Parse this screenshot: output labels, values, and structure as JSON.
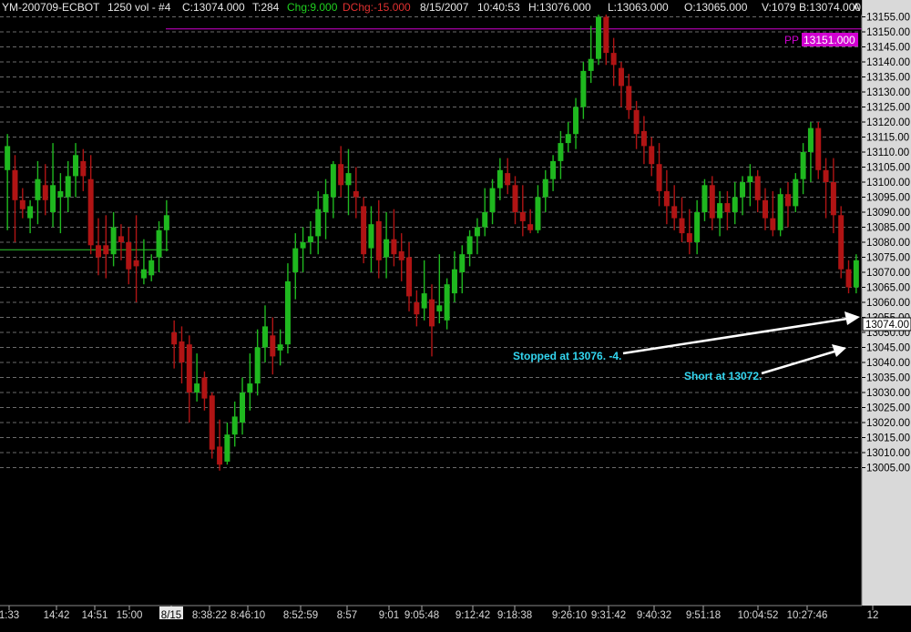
{
  "header": {
    "symbol": "YM-200709-ECBOT",
    "interval": "1250 vol - #4",
    "close": "C:13074.000",
    "ticks": "T:284",
    "change": "Chg:9.000",
    "dchange": "DChg:-15.000",
    "date": "8/15/2007",
    "time": "10:40:53",
    "high": "H:13076.000",
    "low": "L:13063.000",
    "open": "O:13065.000",
    "volume": "V:1079",
    "bid": "B:13074.000",
    "tail": "A"
  },
  "colors": {
    "background": "#000000",
    "up": "#1fb81f",
    "down": "#b01414",
    "grid": "#6a6a6a",
    "pivot": "#d000d0",
    "support": "#2ecc2e",
    "axis_panel": "#d9d9d9",
    "annotation": "#33d6f0"
  },
  "chart_data": {
    "type": "candlestick",
    "ylim": [
      13004,
      13157
    ],
    "y_ticks": [
      "13155.00",
      "13150.00",
      "13145.00",
      "13140.00",
      "13135.00",
      "13130.00",
      "13125.00",
      "13120.00",
      "13115.00",
      "13110.00",
      "13105.00",
      "13100.00",
      "13095.00",
      "13090.00",
      "13085.00",
      "13080.00",
      "13075.00",
      "13070.00",
      "13065.00",
      "13060.00",
      "13055.00",
      "13050.00",
      "13045.00",
      "13040.00",
      "13035.00",
      "13030.00",
      "13025.00",
      "13020.00",
      "13015.00",
      "13010.00",
      "13005.00"
    ],
    "x_labels": [
      "1:33",
      "14:42",
      "14:51",
      "15:00",
      "8/15",
      "8:38:22",
      "8:46:10",
      "8:52:59",
      "8:57",
      "9:01",
      "9:05:48",
      "9:12:42",
      "9:18:38",
      "9:26:10",
      "9:31:42",
      "9:40:32",
      "9:51:18",
      "10:04:52",
      "10:27:46",
      "12"
    ],
    "last_price_label": "13074.00",
    "pivot": {
      "label": "PP",
      "value_label": "13151.000",
      "value": 13151
    },
    "support_level": 13077.5,
    "candles": [
      {
        "o": 13104,
        "h": 13116,
        "l": 13084,
        "c": 13112
      },
      {
        "o": 13104,
        "h": 13109,
        "l": 13080,
        "c": 13094
      },
      {
        "o": 13094,
        "h": 13098,
        "l": 13088,
        "c": 13091
      },
      {
        "o": 13088,
        "h": 13094,
        "l": 13083,
        "c": 13092
      },
      {
        "o": 13094,
        "h": 13107,
        "l": 13086,
        "c": 13101
      },
      {
        "o": 13099,
        "h": 13106,
        "l": 13089,
        "c": 13094
      },
      {
        "o": 13090,
        "h": 13113,
        "l": 13085,
        "c": 13099
      },
      {
        "o": 13095,
        "h": 13103,
        "l": 13083,
        "c": 13097
      },
      {
        "o": 13095,
        "h": 13107,
        "l": 13090,
        "c": 13102
      },
      {
        "o": 13102,
        "h": 13113,
        "l": 13095,
        "c": 13109
      },
      {
        "o": 13107,
        "h": 13111,
        "l": 13097,
        "c": 13102
      },
      {
        "o": 13101,
        "h": 13109,
        "l": 13076,
        "c": 13079
      },
      {
        "o": 13079,
        "h": 13088,
        "l": 13069,
        "c": 13075
      },
      {
        "o": 13079,
        "h": 13089,
        "l": 13068,
        "c": 13076
      },
      {
        "o": 13076,
        "h": 13090,
        "l": 13072,
        "c": 13085
      },
      {
        "o": 13082,
        "h": 13086,
        "l": 13074,
        "c": 13080
      },
      {
        "o": 13080,
        "h": 13085,
        "l": 13066,
        "c": 13071
      },
      {
        "o": 13074,
        "h": 13089,
        "l": 13060,
        "c": 13072
      },
      {
        "o": 13068,
        "h": 13081,
        "l": 13066,
        "c": 13071
      },
      {
        "o": 13069,
        "h": 13076,
        "l": 13067,
        "c": 13074
      },
      {
        "o": 13075,
        "h": 13087,
        "l": 13070,
        "c": 13084
      },
      {
        "o": 13084,
        "h": 13094,
        "l": 13077,
        "c": 13089
      },
      {
        "o": 13050,
        "h": 13054,
        "l": 13038,
        "c": 13046
      },
      {
        "o": 13047,
        "h": 13052,
        "l": 13033,
        "c": 13040
      },
      {
        "o": 13046,
        "h": 13049,
        "l": 13020,
        "c": 13030
      },
      {
        "o": 13030,
        "h": 13043,
        "l": 13027,
        "c": 13033
      },
      {
        "o": 13035,
        "h": 13037,
        "l": 13024,
        "c": 13028
      },
      {
        "o": 13029,
        "h": 13030,
        "l": 13008,
        "c": 13011
      },
      {
        "o": 13012,
        "h": 13021,
        "l": 13004,
        "c": 13006
      },
      {
        "o": 13007,
        "h": 13020,
        "l": 13006,
        "c": 13016
      },
      {
        "o": 13016,
        "h": 13027,
        "l": 13012,
        "c": 13022
      },
      {
        "o": 13020,
        "h": 13035,
        "l": 13016,
        "c": 13030
      },
      {
        "o": 13030,
        "h": 13043,
        "l": 13024,
        "c": 13033
      },
      {
        "o": 13033,
        "h": 13051,
        "l": 13029,
        "c": 13045
      },
      {
        "o": 13045,
        "h": 13059,
        "l": 13040,
        "c": 13052
      },
      {
        "o": 13049,
        "h": 13055,
        "l": 13036,
        "c": 13042
      },
      {
        "o": 13044,
        "h": 13051,
        "l": 13039,
        "c": 13046
      },
      {
        "o": 13046,
        "h": 13073,
        "l": 13043,
        "c": 13067
      },
      {
        "o": 13070,
        "h": 13083,
        "l": 13061,
        "c": 13078
      },
      {
        "o": 13078,
        "h": 13085,
        "l": 13070,
        "c": 13080
      },
      {
        "o": 13080,
        "h": 13087,
        "l": 13076,
        "c": 13082
      },
      {
        "o": 13082,
        "h": 13097,
        "l": 13076,
        "c": 13091
      },
      {
        "o": 13090,
        "h": 13101,
        "l": 13081,
        "c": 13096
      },
      {
        "o": 13095,
        "h": 13107,
        "l": 13088,
        "c": 13106
      },
      {
        "o": 13106,
        "h": 13112,
        "l": 13095,
        "c": 13099
      },
      {
        "o": 13099,
        "h": 13111,
        "l": 13089,
        "c": 13103
      },
      {
        "o": 13097,
        "h": 13105,
        "l": 13088,
        "c": 13095
      },
      {
        "o": 13092,
        "h": 13095,
        "l": 13073,
        "c": 13076
      },
      {
        "o": 13078,
        "h": 13092,
        "l": 13070,
        "c": 13086
      },
      {
        "o": 13087,
        "h": 13094,
        "l": 13068,
        "c": 13074
      },
      {
        "o": 13075,
        "h": 13090,
        "l": 13068,
        "c": 13081
      },
      {
        "o": 13081,
        "h": 13091,
        "l": 13072,
        "c": 13076
      },
      {
        "o": 13077,
        "h": 13083,
        "l": 13067,
        "c": 13074
      },
      {
        "o": 13075,
        "h": 13080,
        "l": 13057,
        "c": 13062
      },
      {
        "o": 13060,
        "h": 13064,
        "l": 13052,
        "c": 13056
      },
      {
        "o": 13058,
        "h": 13074,
        "l": 13054,
        "c": 13063
      },
      {
        "o": 13061,
        "h": 13066,
        "l": 13042,
        "c": 13052
      },
      {
        "o": 13057,
        "h": 13076,
        "l": 13053,
        "c": 13059
      },
      {
        "o": 13054,
        "h": 13068,
        "l": 13051,
        "c": 13066
      },
      {
        "o": 13063,
        "h": 13077,
        "l": 13060,
        "c": 13071
      },
      {
        "o": 13070,
        "h": 13079,
        "l": 13063,
        "c": 13076
      },
      {
        "o": 13076,
        "h": 13084,
        "l": 13072,
        "c": 13082
      },
      {
        "o": 13082,
        "h": 13088,
        "l": 13076,
        "c": 13085
      },
      {
        "o": 13085,
        "h": 13098,
        "l": 13082,
        "c": 13090
      },
      {
        "o": 13090,
        "h": 13101,
        "l": 13086,
        "c": 13098
      },
      {
        "o": 13098,
        "h": 13108,
        "l": 13094,
        "c": 13104
      },
      {
        "o": 13103,
        "h": 13108,
        "l": 13096,
        "c": 13099
      },
      {
        "o": 13099,
        "h": 13102,
        "l": 13086,
        "c": 13090
      },
      {
        "o": 13090,
        "h": 13099,
        "l": 13082,
        "c": 13087
      },
      {
        "o": 13086,
        "h": 13091,
        "l": 13083,
        "c": 13084
      },
      {
        "o": 13084,
        "h": 13099,
        "l": 13083,
        "c": 13095
      },
      {
        "o": 13095,
        "h": 13104,
        "l": 13090,
        "c": 13101
      },
      {
        "o": 13101,
        "h": 13109,
        "l": 13097,
        "c": 13107
      },
      {
        "o": 13107,
        "h": 13117,
        "l": 13101,
        "c": 13113
      },
      {
        "o": 13113,
        "h": 13120,
        "l": 13110,
        "c": 13116
      },
      {
        "o": 13116,
        "h": 13128,
        "l": 13111,
        "c": 13125
      },
      {
        "o": 13125,
        "h": 13140,
        "l": 13121,
        "c": 13137
      },
      {
        "o": 13137,
        "h": 13152,
        "l": 13133,
        "c": 13141
      },
      {
        "o": 13141,
        "h": 13157,
        "l": 13139,
        "c": 13155
      },
      {
        "o": 13155,
        "h": 13157,
        "l": 13139,
        "c": 13143
      },
      {
        "o": 13143,
        "h": 13148,
        "l": 13132,
        "c": 13139
      },
      {
        "o": 13138,
        "h": 13140,
        "l": 13125,
        "c": 13132
      },
      {
        "o": 13132,
        "h": 13136,
        "l": 13121,
        "c": 13124
      },
      {
        "o": 13124,
        "h": 13127,
        "l": 13111,
        "c": 13116
      },
      {
        "o": 13117,
        "h": 13122,
        "l": 13106,
        "c": 13112
      },
      {
        "o": 13112,
        "h": 13115,
        "l": 13102,
        "c": 13106
      },
      {
        "o": 13106,
        "h": 13113,
        "l": 13092,
        "c": 13097
      },
      {
        "o": 13097,
        "h": 13104,
        "l": 13086,
        "c": 13092
      },
      {
        "o": 13092,
        "h": 13099,
        "l": 13084,
        "c": 13088
      },
      {
        "o": 13088,
        "h": 13095,
        "l": 13080,
        "c": 13083
      },
      {
        "o": 13083,
        "h": 13091,
        "l": 13076,
        "c": 13080
      },
      {
        "o": 13080,
        "h": 13094,
        "l": 13076,
        "c": 13090
      },
      {
        "o": 13090,
        "h": 13101,
        "l": 13087,
        "c": 13099
      },
      {
        "o": 13099,
        "h": 13102,
        "l": 13084,
        "c": 13088
      },
      {
        "o": 13088,
        "h": 13097,
        "l": 13082,
        "c": 13093
      },
      {
        "o": 13093,
        "h": 13097,
        "l": 13084,
        "c": 13090
      },
      {
        "o": 13090,
        "h": 13100,
        "l": 13086,
        "c": 13095
      },
      {
        "o": 13095,
        "h": 13102,
        "l": 13089,
        "c": 13100
      },
      {
        "o": 13100,
        "h": 13106,
        "l": 13092,
        "c": 13102
      },
      {
        "o": 13102,
        "h": 13104,
        "l": 13090,
        "c": 13094
      },
      {
        "o": 13094,
        "h": 13098,
        "l": 13084,
        "c": 13088
      },
      {
        "o": 13088,
        "h": 13097,
        "l": 13082,
        "c": 13084
      },
      {
        "o": 13084,
        "h": 13098,
        "l": 13082,
        "c": 13096
      },
      {
        "o": 13096,
        "h": 13100,
        "l": 13085,
        "c": 13092
      },
      {
        "o": 13092,
        "h": 13103,
        "l": 13090,
        "c": 13101
      },
      {
        "o": 13101,
        "h": 13113,
        "l": 13096,
        "c": 13110
      },
      {
        "o": 13110,
        "h": 13120,
        "l": 13100,
        "c": 13118
      },
      {
        "o": 13118,
        "h": 13120,
        "l": 13101,
        "c": 13104
      },
      {
        "o": 13104,
        "h": 13108,
        "l": 13088,
        "c": 13100
      },
      {
        "o": 13100,
        "h": 13108,
        "l": 13083,
        "c": 13089
      },
      {
        "o": 13089,
        "h": 13092,
        "l": 13068,
        "c": 13071
      },
      {
        "o": 13071,
        "h": 13074,
        "l": 13063,
        "c": 13065
      },
      {
        "o": 13065,
        "h": 13076,
        "l": 13063,
        "c": 13074
      }
    ],
    "annotations": [
      {
        "text": "Stopped at 13076.  -4.",
        "price": 13076
      },
      {
        "text": "Short at 13072.",
        "price": 13072
      }
    ]
  }
}
